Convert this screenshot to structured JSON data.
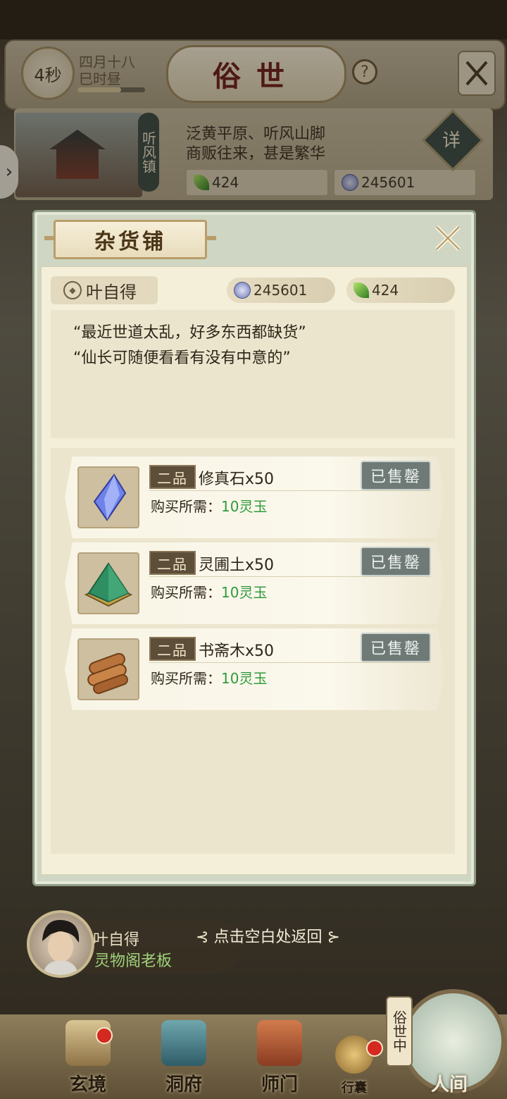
{
  "header": {
    "timer": "4秒",
    "date_line1": "四月十八",
    "date_line2": "巳时昼",
    "date_progress": 0.65,
    "title": "俗世",
    "help_label": "?"
  },
  "town": {
    "name": "听风镇",
    "desc_line1": "泛黄平原、听风山脚",
    "desc_line2": "商贩往来，甚是繁华",
    "resource_leaf": "424",
    "resource_coin": "245601",
    "detail_label": "详"
  },
  "shop": {
    "title": "杂货铺",
    "owner": "叶自得",
    "coin_amount": "245601",
    "leaf_amount": "424",
    "dialog_line1": "“最近世道太乱，好多东西都缺货”",
    "dialog_line2": "“仙长可随便看看有没有中意的”",
    "cost_label": "购买所需：",
    "items": [
      {
        "grade": "二品",
        "name": "修真石x50",
        "cost": "10灵玉",
        "status": "已售罄",
        "icon": "blue-crystal-icon"
      },
      {
        "grade": "二品",
        "name": "灵圃土x50",
        "cost": "10灵玉",
        "status": "已售罄",
        "icon": "green-soil-icon"
      },
      {
        "grade": "二品",
        "name": "书斋木x50",
        "cost": "10灵玉",
        "status": "已售罄",
        "icon": "wood-logs-icon"
      }
    ]
  },
  "npc": {
    "name": "叶自得",
    "title": "灵物阁老板",
    "return_hint": "点击空白处返回"
  },
  "nav": {
    "items": [
      {
        "label": "玄境"
      },
      {
        "label": "洞府"
      },
      {
        "label": "师门"
      },
      {
        "label": "行囊"
      },
      {
        "label": "人间"
      }
    ],
    "side_tag": "俗世中"
  },
  "colors": {
    "cost_green": "#2f9a3c",
    "title_red": "#6e1e1a",
    "panel_green": "#cfd6c3"
  }
}
